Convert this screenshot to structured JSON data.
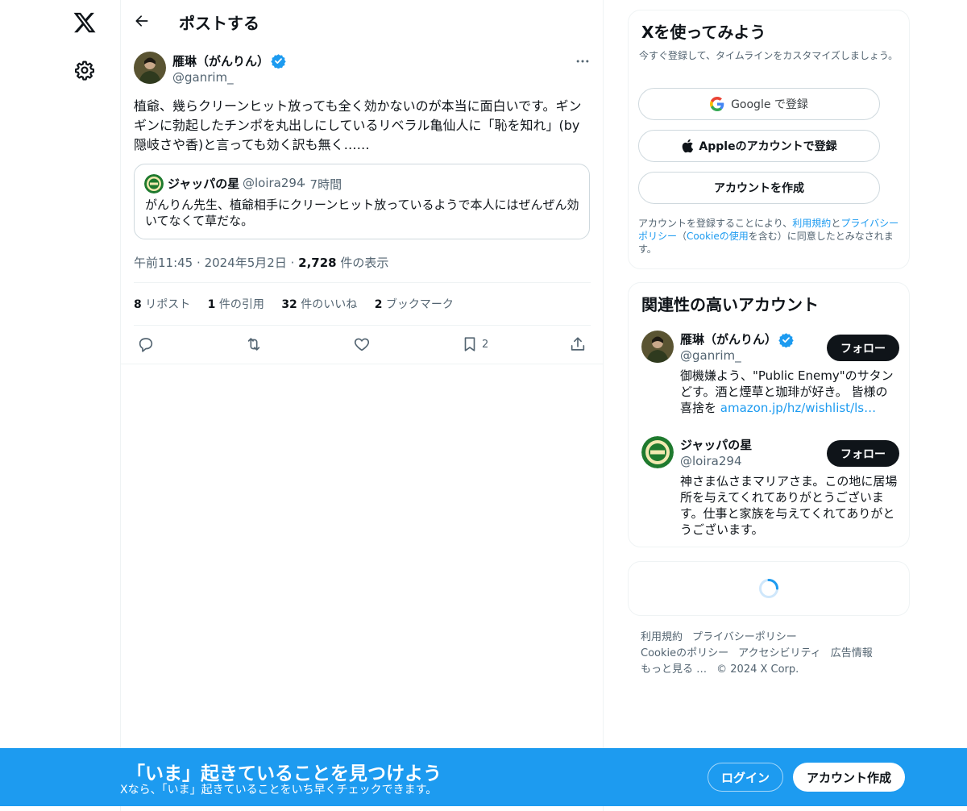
{
  "header": {
    "title": "ポストする"
  },
  "post": {
    "author_name": "雁琳（がんりん）",
    "author_handle": "@ganrim_",
    "text": "植爺、幾らクリーンヒット放っても全く効かないのが本当に面白いです。ギンギンに勃起したチンポを丸出しにしているリベラル亀仙人に「恥を知れ」(by 隠岐さや香)と言っても効く訳も無く……",
    "quote": {
      "name": "ジャッパの星",
      "handle": "@loira294",
      "time": "· 7時間",
      "text": "がんりん先生、植爺相手にクリーンヒット放っているようで本人にはぜんぜん効いてなくて草だな。"
    },
    "time": "午前11:45",
    "date": "2024年5月2日",
    "views_count": "2,728",
    "views_label": " 件の表示",
    "stats": [
      {
        "count": "8",
        "label": " リポスト"
      },
      {
        "count": "1",
        "label": " 件の引用"
      },
      {
        "count": "32",
        "label": " 件のいいね"
      },
      {
        "count": "2",
        "label": " ブックマーク"
      }
    ],
    "bookmark_count": "2"
  },
  "signup_card": {
    "title": "Xを使ってみよう",
    "subtitle": "今すぐ登録して、タイムラインをカスタマイズしましょう。",
    "google_label": "Google で登録",
    "apple_label": "Appleのアカウントで登録",
    "create_label": "アカウントを作成",
    "legal_pre": "アカウントを登録することにより、",
    "legal_terms": "利用規約",
    "legal_and": "と",
    "legal_privacy": "プライバシーポリシー",
    "legal_mid": "（",
    "legal_cookie": "Cookieの使用",
    "legal_post": "を含む）に同意したとみなされます。"
  },
  "related_card": {
    "title": "関連性の高いアカウント",
    "accounts": [
      {
        "name": "雁琳（がんりん）",
        "handle": "@ganrim_",
        "bio": "御機嫌よう、\"Public Enemy\"のサタンどす。酒と煙草と珈琲が好き。 皆様の喜捨を ",
        "bio_link": "amazon.jp/hz/wishlist/ls…",
        "follow_label": "フォロー"
      },
      {
        "name": "ジャッパの星",
        "handle": "@loira294",
        "bio": "神さま仏さまマリアさま。この地に居場所を与えてくれてありがとうございます。仕事と家族を与えてくれてありがとうございます。",
        "follow_label": "フォロー"
      }
    ]
  },
  "footer": {
    "links": [
      "利用規約",
      "プライバシーポリシー",
      "Cookieのポリシー",
      "アクセシビリティ",
      "広告情報",
      "もっと見る …"
    ],
    "copyright": "© 2024 X Corp."
  },
  "banner": {
    "title": "「いま」起きていることを見つけよう",
    "subtitle": "Xなら、「いま」起きていることをいち早くチェックできます。",
    "login_label": "ログイン",
    "signup_label": "アカウント作成"
  },
  "colors": {
    "accent": "#1d9bf0",
    "text": "#0f1419",
    "muted": "#536471",
    "border": "#eff3f4"
  }
}
